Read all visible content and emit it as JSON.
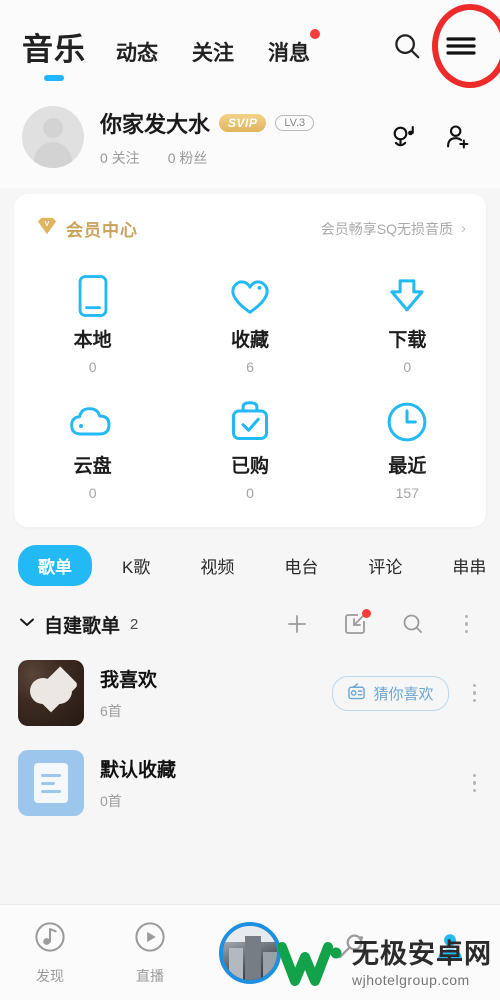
{
  "topnav": {
    "tabs": [
      {
        "label": "音乐",
        "active": true,
        "badge": false
      },
      {
        "label": "动态",
        "active": false,
        "badge": false
      },
      {
        "label": "关注",
        "active": false,
        "badge": false
      },
      {
        "label": "消息",
        "active": false,
        "badge": true
      }
    ],
    "search_icon": "search-icon",
    "menu_icon": "hamburger-menu-icon",
    "highlight_color": "#ed2b2b"
  },
  "profile": {
    "nickname": "你家发大水",
    "vip_badge": "SVIP",
    "level_badge": "LV.3",
    "following": "0 关注",
    "followers": "0 粉丝",
    "action_icons": [
      "mic-music-icon",
      "add-friend-icon"
    ]
  },
  "vip": {
    "title": "会员中心",
    "subtitle": "会员畅享SQ无损音质",
    "chevron": "›",
    "accent": "#c9a25c"
  },
  "grid": {
    "items": [
      {
        "label": "本地",
        "count": "0",
        "icon": "phone-icon"
      },
      {
        "label": "收藏",
        "count": "6",
        "icon": "heart-icon"
      },
      {
        "label": "下载",
        "count": "0",
        "icon": "download-icon"
      },
      {
        "label": "云盘",
        "count": "0",
        "icon": "cloud-icon"
      },
      {
        "label": "已购",
        "count": "0",
        "icon": "bag-check-icon"
      },
      {
        "label": "最近",
        "count": "157",
        "icon": "clock-icon"
      }
    ],
    "accent": "#22b9f4"
  },
  "categories": [
    {
      "label": "歌单",
      "active": true
    },
    {
      "label": "K歌",
      "active": false
    },
    {
      "label": "视频",
      "active": false
    },
    {
      "label": "电台",
      "active": false
    },
    {
      "label": "评论",
      "active": false
    },
    {
      "label": "串串",
      "active": false
    }
  ],
  "section": {
    "title": "自建歌单",
    "count": "2",
    "collapse_icon": "chevron-down-icon",
    "actions": [
      "add-icon",
      "import-icon",
      "search-icon",
      "more-icon"
    ],
    "import_badge": true
  },
  "playlists": [
    {
      "name": "我喜欢",
      "sub": "6首",
      "thumb": "heart-photo-thumb",
      "action_label": "猜你喜欢",
      "action_icon": "radio-icon",
      "has_action": true
    },
    {
      "name": "默认收藏",
      "sub": "0首",
      "thumb": "document-list-thumb",
      "action_label": "",
      "action_icon": "",
      "has_action": false
    }
  ],
  "bottomnav": [
    {
      "label": "发现",
      "icon": "disc-note-icon",
      "active": false
    },
    {
      "label": "直播",
      "icon": "play-circle-icon",
      "active": false
    },
    {
      "label": "",
      "icon": "now-playing-disc",
      "active": false
    },
    {
      "label": "",
      "icon": "karaoke-mic-icon",
      "active": false
    },
    {
      "label": "",
      "icon": "person-icon",
      "active": true
    }
  ],
  "watermark": {
    "logo": "w-logo-green",
    "title": "无极安卓网",
    "url": "wjhotelgroup.com",
    "color": "#11a24a"
  }
}
